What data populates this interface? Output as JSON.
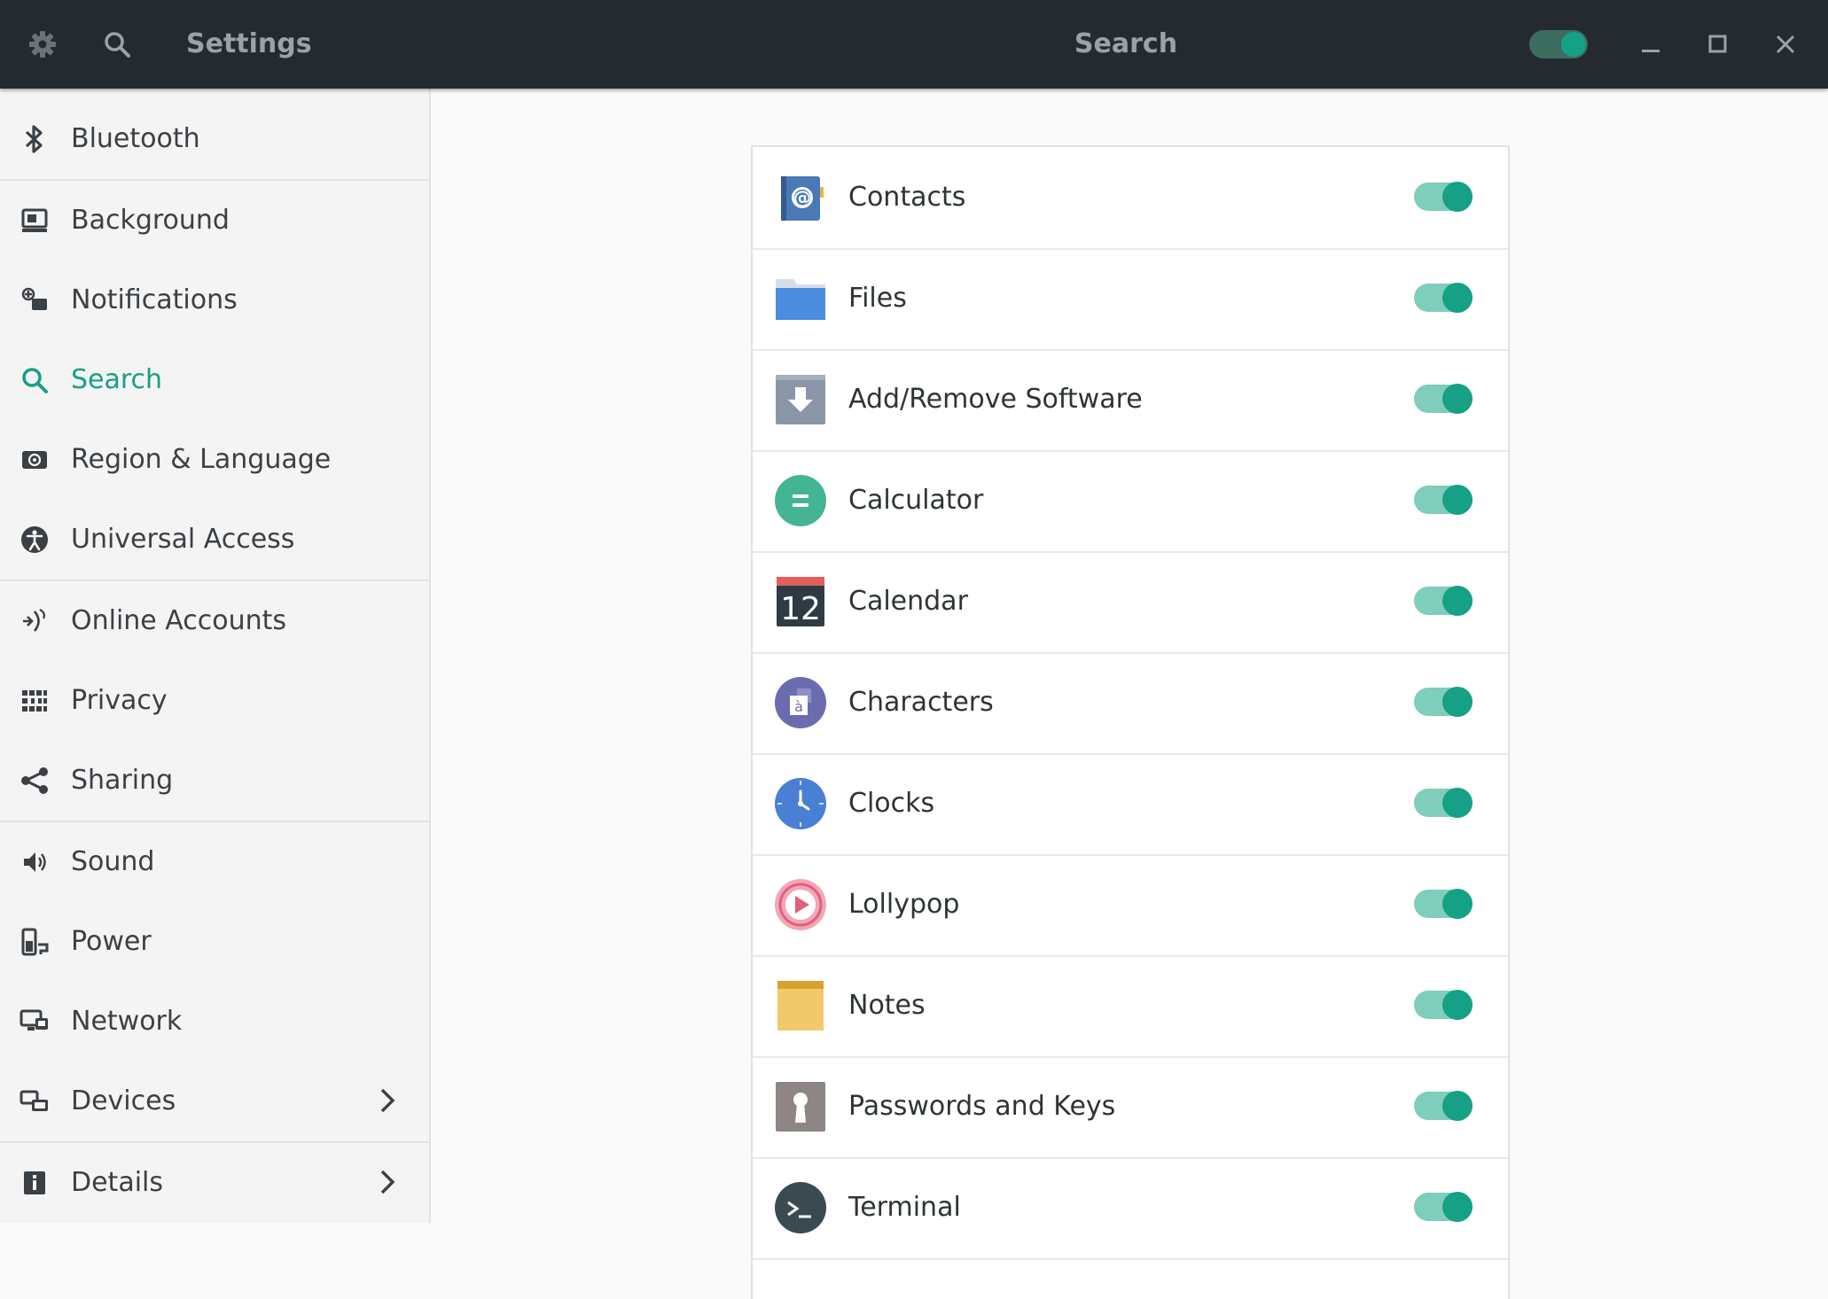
{
  "header": {
    "left_title": "Settings",
    "center_title": "Search",
    "search_switch_on": true,
    "icons": [
      "gear-icon",
      "search-icon",
      "minimize-icon",
      "maximize-icon",
      "close-icon"
    ]
  },
  "sidebar": {
    "items": [
      {
        "label": "Bluetooth",
        "icon": "bluetooth-icon"
      },
      {
        "label": "Background",
        "icon": "background-icon"
      },
      {
        "label": "Notifications",
        "icon": "notifications-icon"
      },
      {
        "label": "Search",
        "icon": "search-icon",
        "active": true
      },
      {
        "label": "Region & Language",
        "icon": "region-icon"
      },
      {
        "label": "Universal Access",
        "icon": "accessibility-icon"
      },
      {
        "label": "Online Accounts",
        "icon": "online-accounts-icon"
      },
      {
        "label": "Privacy",
        "icon": "privacy-icon"
      },
      {
        "label": "Sharing",
        "icon": "share-icon"
      },
      {
        "label": "Sound",
        "icon": "sound-icon"
      },
      {
        "label": "Power",
        "icon": "power-icon"
      },
      {
        "label": "Network",
        "icon": "network-icon"
      },
      {
        "label": "Devices",
        "icon": "devices-icon",
        "has_submenu": true
      },
      {
        "label": "Details",
        "icon": "details-icon",
        "has_submenu": true
      }
    ],
    "accent_color": "#16a085"
  },
  "search_providers": [
    {
      "label": "Contacts",
      "icon": "contacts-icon",
      "enabled": true
    },
    {
      "label": "Files",
      "icon": "files-folder-icon",
      "enabled": true
    },
    {
      "label": "Add/Remove Software",
      "icon": "software-icon",
      "enabled": true
    },
    {
      "label": "Calculator",
      "icon": "calculator-icon",
      "enabled": true
    },
    {
      "label": "Calendar",
      "icon": "calendar-icon",
      "calendar_day": "12",
      "enabled": true
    },
    {
      "label": "Characters",
      "icon": "characters-icon",
      "enabled": true
    },
    {
      "label": "Clocks",
      "icon": "clocks-icon",
      "enabled": true
    },
    {
      "label": "Lollypop",
      "icon": "lollypop-icon",
      "enabled": true
    },
    {
      "label": "Notes",
      "icon": "notes-icon",
      "enabled": true
    },
    {
      "label": "Passwords and Keys",
      "icon": "passwords-keys-icon",
      "enabled": true
    },
    {
      "label": "Terminal",
      "icon": "terminal-icon",
      "enabled": true
    }
  ],
  "colors": {
    "header_bg": "#252a30",
    "toggle_track": "#7fcdbb",
    "toggle_knob": "#16a085"
  }
}
